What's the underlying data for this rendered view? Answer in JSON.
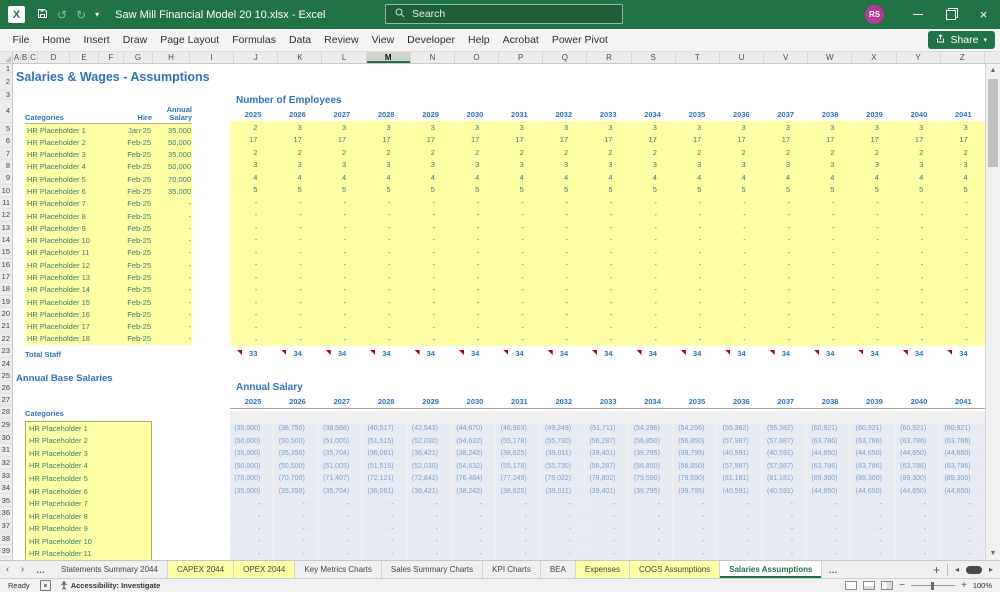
{
  "titlebar": {
    "app_title": "Saw Mill Financial Model 20 10.xlsx - Excel",
    "search_placeholder": "Search",
    "avatar_initials": "RS"
  },
  "ribbon": {
    "tabs": [
      "File",
      "Home",
      "Insert",
      "Draw",
      "Page Layout",
      "Formulas",
      "Data",
      "Review",
      "View",
      "Developer",
      "Help",
      "Acrobat",
      "Power Pivot"
    ],
    "share_label": "Share"
  },
  "grid": {
    "column_letters": [
      "A",
      "B",
      "C",
      "D",
      "E",
      "F",
      "G",
      "H",
      "I",
      "J",
      "K",
      "L",
      "M",
      "N",
      "O",
      "P",
      "Q",
      "R",
      "S",
      "T",
      "U",
      "V",
      "W",
      "X",
      "Y",
      "Z"
    ],
    "selected_column": "M",
    "row_count": 39
  },
  "sheet": {
    "page_title": "Salaries & Wages - Assumptions",
    "staff_table": {
      "headers": [
        "Categories",
        "Hire",
        "Annual Salary"
      ],
      "rows": [
        {
          "category": "HR Placeholder 1",
          "hire": "Jan-25",
          "salary": "35,000"
        },
        {
          "category": "HR Placeholder 2",
          "hire": "Feb-25",
          "salary": "50,000"
        },
        {
          "category": "HR Placeholder 3",
          "hire": "Feb-25",
          "salary": "35,000"
        },
        {
          "category": "HR Placeholder 4",
          "hire": "Feb-25",
          "salary": "50,000"
        },
        {
          "category": "HR Placeholder 5",
          "hire": "Feb-25",
          "salary": "70,000"
        },
        {
          "category": "HR Placeholder 6",
          "hire": "Feb-25",
          "salary": "35,000"
        },
        {
          "category": "HR Placeholder 7",
          "hire": "Feb-25",
          "salary": "-"
        },
        {
          "category": "HR Placeholder 8",
          "hire": "Feb-25",
          "salary": "-"
        },
        {
          "category": "HR Placeholder 9",
          "hire": "Feb-25",
          "salary": "-"
        },
        {
          "category": "HR Placeholder 10",
          "hire": "Feb-25",
          "salary": "-"
        },
        {
          "category": "HR Placeholder 11",
          "hire": "Feb-25",
          "salary": "-"
        },
        {
          "category": "HR Placeholder 12",
          "hire": "Feb-25",
          "salary": "-"
        },
        {
          "category": "HR Placeholder 13",
          "hire": "Feb-25",
          "salary": "-"
        },
        {
          "category": "HR Placeholder 14",
          "hire": "Feb-25",
          "salary": "-"
        },
        {
          "category": "HR Placeholder 15",
          "hire": "Feb-25",
          "salary": "-"
        },
        {
          "category": "HR Placeholder 16",
          "hire": "Feb-25",
          "salary": "-"
        },
        {
          "category": "HR Placeholder 17",
          "hire": "Feb-25",
          "salary": "-"
        },
        {
          "category": "HR Placeholder 18",
          "hire": "Feb-25",
          "salary": "-"
        }
      ],
      "total_label": "Total Staff"
    },
    "base_salaries": {
      "heading": "Annual Base Salaries",
      "column_header": "Categories",
      "rows": [
        "HR Placeholder 1",
        "HR Placeholder 2",
        "HR Placeholder 3",
        "HR Placeholder 4",
        "HR Placeholder 5",
        "HR Placeholder 6",
        "HR Placeholder 7",
        "HR Placeholder 8",
        "HR Placeholder 9",
        "HR Placeholder 10",
        "HR Placeholder 11"
      ]
    },
    "employees": {
      "heading": "Number of Employees",
      "years": [
        "2025",
        "2026",
        "2027",
        "2028",
        "2029",
        "2030",
        "2031",
        "2032",
        "2033",
        "2034",
        "2035",
        "2036",
        "2037",
        "2038",
        "2039",
        "2040",
        "2041"
      ],
      "rows": [
        [
          "2",
          "3",
          "3",
          "3",
          "3",
          "3",
          "3",
          "3",
          "3",
          "3",
          "3",
          "3",
          "3",
          "3",
          "3",
          "3",
          "3"
        ],
        [
          "17",
          "17",
          "17",
          "17",
          "17",
          "17",
          "17",
          "17",
          "17",
          "17",
          "17",
          "17",
          "17",
          "17",
          "17",
          "17",
          "17"
        ],
        [
          "2",
          "2",
          "2",
          "2",
          "2",
          "2",
          "2",
          "2",
          "2",
          "2",
          "2",
          "2",
          "2",
          "2",
          "2",
          "2",
          "2"
        ],
        [
          "3",
          "3",
          "3",
          "3",
          "3",
          "3",
          "3",
          "3",
          "3",
          "3",
          "3",
          "3",
          "3",
          "3",
          "3",
          "3",
          "3"
        ],
        [
          "4",
          "4",
          "4",
          "4",
          "4",
          "4",
          "4",
          "4",
          "4",
          "4",
          "4",
          "4",
          "4",
          "4",
          "4",
          "4",
          "4"
        ],
        [
          "5",
          "5",
          "5",
          "5",
          "5",
          "5",
          "5",
          "5",
          "5",
          "5",
          "5",
          "5",
          "5",
          "5",
          "5",
          "5",
          "5"
        ]
      ],
      "empty_rows": 12,
      "empty_value": "-",
      "totals": [
        "33",
        "34",
        "34",
        "34",
        "34",
        "34",
        "34",
        "34",
        "34",
        "34",
        "34",
        "34",
        "34",
        "34",
        "34",
        "34",
        "34"
      ]
    },
    "salaries": {
      "heading": "Annual Salary",
      "years": [
        "2025",
        "2026",
        "2027",
        "2028",
        "2029",
        "2030",
        "2031",
        "2032",
        "2033",
        "2034",
        "2035",
        "2036",
        "2037",
        "2038",
        "2039",
        "2040",
        "2041"
      ],
      "rows": [
        [
          "(35,000)",
          "(36,750)",
          "(38,588)",
          "(40,517)",
          "(42,543)",
          "(44,670)",
          "(46,903)",
          "(49,249)",
          "(51,711)",
          "(54,296)",
          "(54,296)",
          "(55,382)",
          "(55,382)",
          "(60,921)",
          "(60,921)",
          "(60,921)",
          "(60,921)"
        ],
        [
          "(50,000)",
          "(50,500)",
          "(51,005)",
          "(51,515)",
          "(52,030)",
          "(54,632)",
          "(55,178)",
          "(55,730)",
          "(56,287)",
          "(56,850)",
          "(56,850)",
          "(57,987)",
          "(57,987)",
          "(63,786)",
          "(63,786)",
          "(63,786)",
          "(63,786)"
        ],
        [
          "(35,000)",
          "(35,350)",
          "(35,704)",
          "(36,061)",
          "(36,421)",
          "(38,242)",
          "(38,625)",
          "(39,011)",
          "(39,401)",
          "(39,795)",
          "(39,795)",
          "(40,591)",
          "(40,591)",
          "(44,650)",
          "(44,650)",
          "(44,650)",
          "(44,650)"
        ],
        [
          "(50,000)",
          "(50,500)",
          "(51,005)",
          "(51,515)",
          "(52,030)",
          "(54,632)",
          "(55,178)",
          "(55,730)",
          "(56,287)",
          "(56,850)",
          "(56,850)",
          "(57,987)",
          "(57,987)",
          "(63,786)",
          "(63,786)",
          "(63,786)",
          "(63,786)"
        ],
        [
          "(70,000)",
          "(70,700)",
          "(71,407)",
          "(72,121)",
          "(72,842)",
          "(76,484)",
          "(77,249)",
          "(78,022)",
          "(78,802)",
          "(79,590)",
          "(79,590)",
          "(81,181)",
          "(81,181)",
          "(89,300)",
          "(89,300)",
          "(89,300)",
          "(89,300)"
        ],
        [
          "(35,000)",
          "(35,350)",
          "(35,704)",
          "(36,061)",
          "(36,421)",
          "(38,242)",
          "(38,625)",
          "(39,011)",
          "(39,401)",
          "(39,795)",
          "(39,795)",
          "(40,591)",
          "(40,591)",
          "(44,650)",
          "(44,650)",
          "(44,650)",
          "(44,650)"
        ]
      ],
      "empty_rows": 5,
      "empty_value": "-"
    }
  },
  "tabbar": {
    "tabs": [
      {
        "label": "Statements Summary 2044",
        "style": "normal"
      },
      {
        "label": "CAPEX 2044",
        "style": "yellow"
      },
      {
        "label": "OPEX 2044",
        "style": "yellow"
      },
      {
        "label": "Key Metrics Charts",
        "style": "normal"
      },
      {
        "label": "Sales Summary Charts",
        "style": "normal"
      },
      {
        "label": "KPI Charts",
        "style": "normal"
      },
      {
        "label": "BEA",
        "style": "normal"
      },
      {
        "label": "Expenses",
        "style": "yellow"
      },
      {
        "label": "COGS Assumptions",
        "style": "yellow"
      },
      {
        "label": "Salaries Assumptions",
        "style": "active"
      }
    ]
  },
  "statusbar": {
    "ready": "Ready",
    "accessibility": "Accessibility: Investigate",
    "zoom_level": "100%"
  },
  "colors": {
    "titlebar_green": "#217346",
    "active_tab_green": "#1e7145",
    "input_yellow": "#ffffa5",
    "heading_blue": "#2e75b6",
    "input_text_teal": "#3d7a70",
    "salary_text_blue": "#7d9fce",
    "marker_red": "#b30000",
    "avatar_magenta": "#b43a9b"
  }
}
